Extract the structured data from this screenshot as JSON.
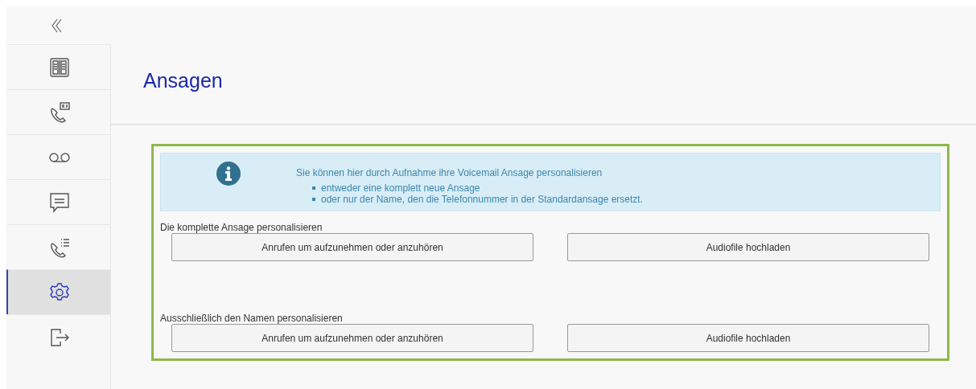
{
  "sidebar": {
    "items": [
      {
        "selected": false
      },
      {
        "selected": false
      },
      {
        "selected": false
      },
      {
        "selected": false
      },
      {
        "selected": false
      },
      {
        "selected": true
      },
      {
        "selected": false
      }
    ]
  },
  "page": {
    "title": "Ansagen"
  },
  "info": {
    "text": "Sie können hier durch Aufnahme ihre Voicemail Ansage personalisieren",
    "bullets": [
      "entweder eine komplett neue Ansage",
      "oder nur der Name, den die Telefonnummer in der Standardansage ersetzt."
    ]
  },
  "sections": [
    {
      "label": "Die komplette Ansage personalisieren",
      "buttons": [
        "Anrufen um aufzunehmen oder anzuhören",
        "Audiofile hochladen"
      ]
    },
    {
      "label": "Ausschließlich den Namen personalisieren",
      "buttons": [
        "Anrufen um aufzunehmen oder anzuhören",
        "Audiofile hochladen"
      ]
    }
  ]
}
